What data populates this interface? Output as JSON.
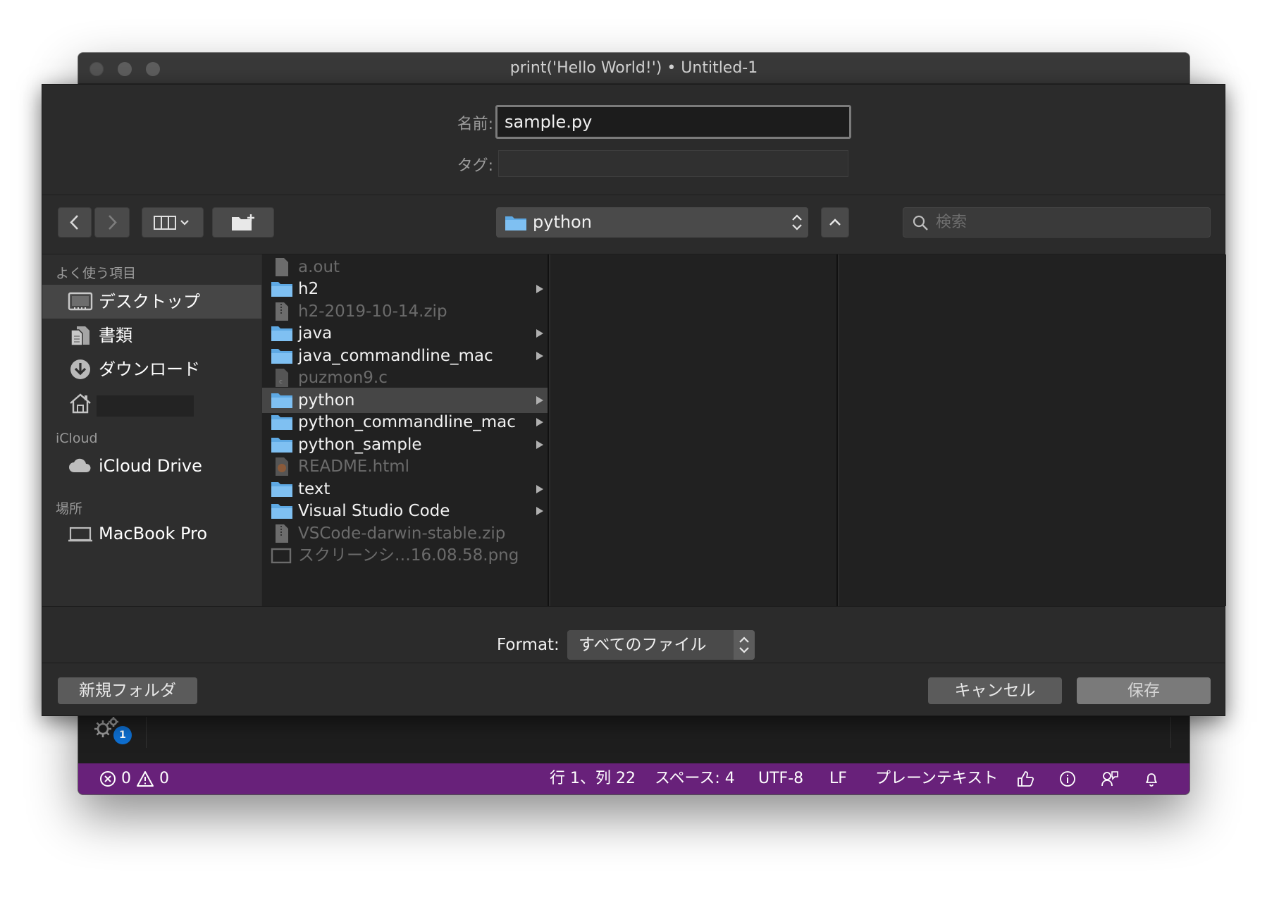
{
  "window": {
    "title": "print('Hello World!') • Untitled-1"
  },
  "dialog": {
    "name_label": "名前:",
    "name_value": "sample.py",
    "tag_label": "タグ:",
    "tag_value": "",
    "location": {
      "label": "python",
      "icon": "folder-icon"
    },
    "search_placeholder": "検索",
    "sidebar": {
      "favorites_header": "よく使う項目",
      "favorites": [
        {
          "label": "デスクトップ",
          "icon": "desktop-icon",
          "selected": true
        },
        {
          "label": "書類",
          "icon": "documents-icon",
          "selected": false
        },
        {
          "label": "ダウンロード",
          "icon": "downloads-icon",
          "selected": false
        },
        {
          "label": "",
          "icon": "home-icon",
          "selected": false
        }
      ],
      "icloud_header": "iCloud",
      "icloud_items": [
        {
          "label": "iCloud Drive",
          "icon": "cloud-icon"
        }
      ],
      "locations_header": "場所",
      "location_items": [
        {
          "label": "MacBook Pro",
          "icon": "laptop-icon"
        }
      ]
    },
    "files": [
      {
        "name": "a.out",
        "type": "file",
        "icon": "document-icon"
      },
      {
        "name": "h2",
        "type": "folder",
        "icon": "folder-icon"
      },
      {
        "name": "h2-2019-10-14.zip",
        "type": "file",
        "icon": "zip-icon"
      },
      {
        "name": "java",
        "type": "folder",
        "icon": "folder-icon"
      },
      {
        "name": "java_commandline_mac",
        "type": "folder",
        "icon": "folder-icon"
      },
      {
        "name": "puzmon9.c",
        "type": "file",
        "icon": "c-file-icon"
      },
      {
        "name": "python",
        "type": "folder",
        "icon": "folder-icon",
        "selected": true
      },
      {
        "name": "python_commandline_mac",
        "type": "folder",
        "icon": "folder-icon"
      },
      {
        "name": "python_sample",
        "type": "folder",
        "icon": "folder-icon"
      },
      {
        "name": "README.html",
        "type": "file",
        "icon": "html-file-icon"
      },
      {
        "name": "text",
        "type": "folder",
        "icon": "folder-icon"
      },
      {
        "name": "Visual Studio Code",
        "type": "folder",
        "icon": "folder-icon"
      },
      {
        "name": "VSCode-darwin-stable.zip",
        "type": "file",
        "icon": "zip-icon"
      },
      {
        "name": "スクリーンシ…16.08.58.png",
        "type": "file",
        "icon": "image-file-icon"
      }
    ],
    "format_label": "Format:",
    "format_value": "すべてのファイル",
    "new_folder_button": "新規フォルダ",
    "cancel_button": "キャンセル",
    "save_button": "保存"
  },
  "editor": {
    "notification_badge": "1"
  },
  "statusbar": {
    "errors": "0",
    "warnings": "0",
    "position": "行 1、列 22",
    "spaces": "スペース: 4",
    "encoding": "UTF-8",
    "eol": "LF",
    "language": "プレーンテキスト"
  },
  "colors": {
    "statusbar_bg": "#68217a",
    "folder_blue": "#5ea9e4",
    "sheet_bg": "#2b2b2b",
    "badge_blue": "#0e6fd1"
  }
}
